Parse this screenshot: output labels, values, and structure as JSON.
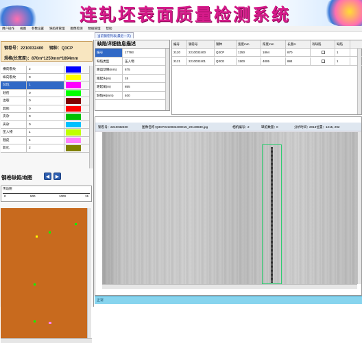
{
  "app": {
    "title": "连轧坯表面质量检测系统"
  },
  "menu": [
    "用户操作",
    "视图",
    "参数设置",
    "缺陷库管理",
    "图像检测",
    "数据管理",
    "帮助"
  ],
  "left": {
    "steel_no_label": "钢卷号：",
    "steel_no": "2210032400",
    "grade_label": "钢种：",
    "grade": "Q3CP",
    "spec_label": "规格(长宽厚)：",
    "spec": "870m*1250mm*1894mm",
    "defects": [
      {
        "name": "横向裂纹",
        "count": "2",
        "color": "#0000ff"
      },
      {
        "name": "纵向裂纹",
        "count": "0",
        "color": "#ffff00"
      },
      {
        "name": "凹坑",
        "count": "1",
        "color": "#ff00ff"
      },
      {
        "name": "划伤",
        "count": "0",
        "color": "#00ff00"
      },
      {
        "name": "边裂",
        "count": "0",
        "color": "#800000"
      },
      {
        "name": "其他",
        "count": "0",
        "color": "#ff0000"
      },
      {
        "name": "夹杂",
        "count": "0",
        "color": "#00c000"
      },
      {
        "name": "夹杂",
        "count": "0",
        "color": "#00c0ff"
      },
      {
        "name": "压入物",
        "count": "1",
        "color": "#c0ff00"
      },
      {
        "name": "翘皮",
        "count": "4",
        "color": "#ff80ff"
      },
      {
        "name": "氧化",
        "count": "2",
        "color": "#808000"
      }
    ],
    "map_title": "钢卷缺陷地图",
    "prev_icon": "◀",
    "next_icon": "▶",
    "ruler_title": "传动侧",
    "ruler_ticks": [
      "0",
      "500",
      "1000",
      "15"
    ]
  },
  "detail": {
    "tab": "当前钢卷列表(最近一天)",
    "header": "缺陷详细信息描述",
    "rows": [
      {
        "k": "编号",
        "v": "17793"
      },
      {
        "k": "缺陷类型",
        "v": "压入物"
      },
      {
        "k": "距运动侧(mm)",
        "v": "675"
      },
      {
        "k": "距起头(m)",
        "v": "15"
      },
      {
        "k": "距起尾(m)",
        "v": "855"
      },
      {
        "k": "缺陷长(mm)",
        "v": "400"
      }
    ]
  },
  "grid": {
    "headers": [
      "编号",
      "钢卷号",
      "钢种",
      "宽度mm",
      "厚度mm",
      "长度m",
      "有缺陷",
      "缺陷"
    ],
    "rows": [
      [
        "2120",
        "2210032400",
        "Q3CP",
        "1250",
        "1894",
        "870",
        "",
        "1"
      ],
      [
        "2121",
        "2210032401",
        "Q3CE",
        "1500",
        "4005",
        "884",
        "",
        "1"
      ]
    ]
  },
  "image": {
    "steel_label": "钢卷号：",
    "steel_no": "2210032400",
    "name_label": "图像名称：",
    "name": "Q3CP2210032400015_20130830.jpg",
    "camera_label": "相机编号：",
    "camera": "2",
    "count_label": "缺陷数量：",
    "count": "0",
    "time_label": "分析时间：",
    "time": "2013位置：1215, 292"
  },
  "status": {
    "text": "正常"
  }
}
